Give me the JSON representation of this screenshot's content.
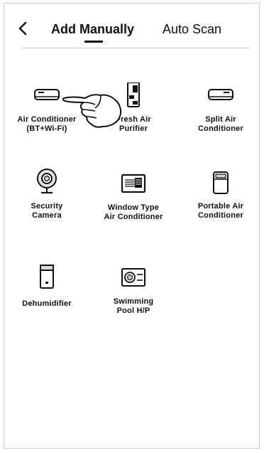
{
  "header": {
    "tabs": [
      {
        "label": "Add Manually",
        "active": true
      },
      {
        "label": "Auto Scan",
        "active": false
      }
    ]
  },
  "devices": [
    {
      "line1": "Air Conditioner",
      "line2": "(BT+Wi-Fi)",
      "icon": "split-ac-icon"
    },
    {
      "line1": "Fresh Air",
      "line2": "Purifier",
      "icon": "fresh-air-purifier-icon"
    },
    {
      "line1": "Split Air",
      "line2": "Conditioner",
      "icon": "split-ac-icon"
    },
    {
      "line1": "Security",
      "line2": "Camera",
      "icon": "security-camera-icon"
    },
    {
      "line1": "Window Type",
      "line2": "Air Conditioner",
      "icon": "window-ac-icon"
    },
    {
      "line1": "Portable Air",
      "line2": "Conditioner",
      "icon": "portable-ac-icon"
    },
    {
      "line1": "Dehumidifier",
      "line2": "",
      "icon": "dehumidifier-icon"
    },
    {
      "line1": "Swimming",
      "line2": "Pool H/P",
      "icon": "pool-heat-pump-icon"
    }
  ]
}
